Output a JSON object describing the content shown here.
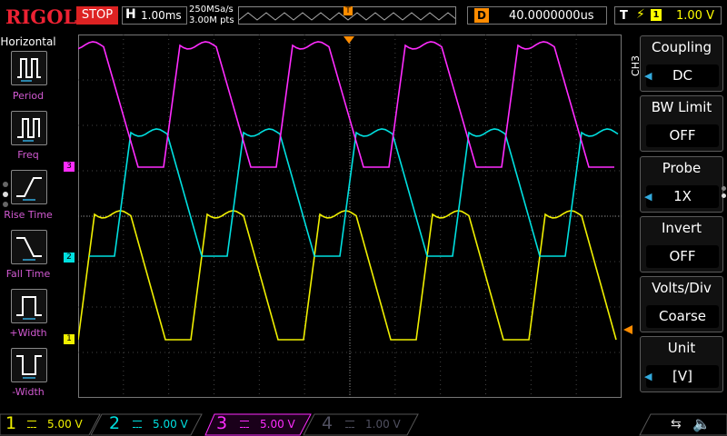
{
  "topbar": {
    "brand": "RIGOL",
    "run_state": "STOP",
    "timebase_label": "H",
    "timebase_value": "1.00ms",
    "sample_rate": "250MSa/s",
    "memory_depth": "3.00M pts",
    "delay_label": "D",
    "delay_value": "40.0000000us",
    "trigger_label": "T",
    "trigger_source": "1",
    "trigger_level": "1.00 V"
  },
  "left_menu": {
    "title": "Horizontal",
    "items": [
      {
        "label": "Period",
        "icon": "period-icon"
      },
      {
        "label": "Freq",
        "icon": "frequency-icon"
      },
      {
        "label": "Rise Time",
        "icon": "rise-time-icon"
      },
      {
        "label": "Fall Time",
        "icon": "fall-time-icon"
      },
      {
        "label": "+Width",
        "icon": "positive-width-icon"
      },
      {
        "label": "-Width",
        "icon": "negative-width-icon"
      }
    ]
  },
  "right_menu": {
    "channel_tag": "CH3",
    "items": [
      {
        "title": "Coupling",
        "value": "DC"
      },
      {
        "title": "BW Limit",
        "value": "OFF"
      },
      {
        "title": "Probe",
        "value": "1X"
      },
      {
        "title": "Invert",
        "value": "OFF"
      },
      {
        "title": "Volts/Div",
        "value": "Coarse"
      },
      {
        "title": "Unit",
        "value": "[V]"
      }
    ]
  },
  "channels": [
    {
      "num": "1",
      "scale": "5.00 V",
      "color": "#f0f000"
    },
    {
      "num": "2",
      "scale": "5.00 V",
      "color": "#00e0e0"
    },
    {
      "num": "3",
      "scale": "5.00 V",
      "color": "#ff2cff"
    },
    {
      "num": "4",
      "scale": "1.00 V",
      "color": "#505060"
    }
  ],
  "markers": {
    "ch1": "1",
    "ch2": "2",
    "ch3": "3",
    "trigger": "T"
  },
  "colors": {
    "ch1": "#f0f000",
    "ch2": "#00e0e0",
    "ch3": "#ff2cff",
    "ch4": "#505060",
    "trigger": "#ff8c00",
    "stop": "#dd2222"
  }
}
